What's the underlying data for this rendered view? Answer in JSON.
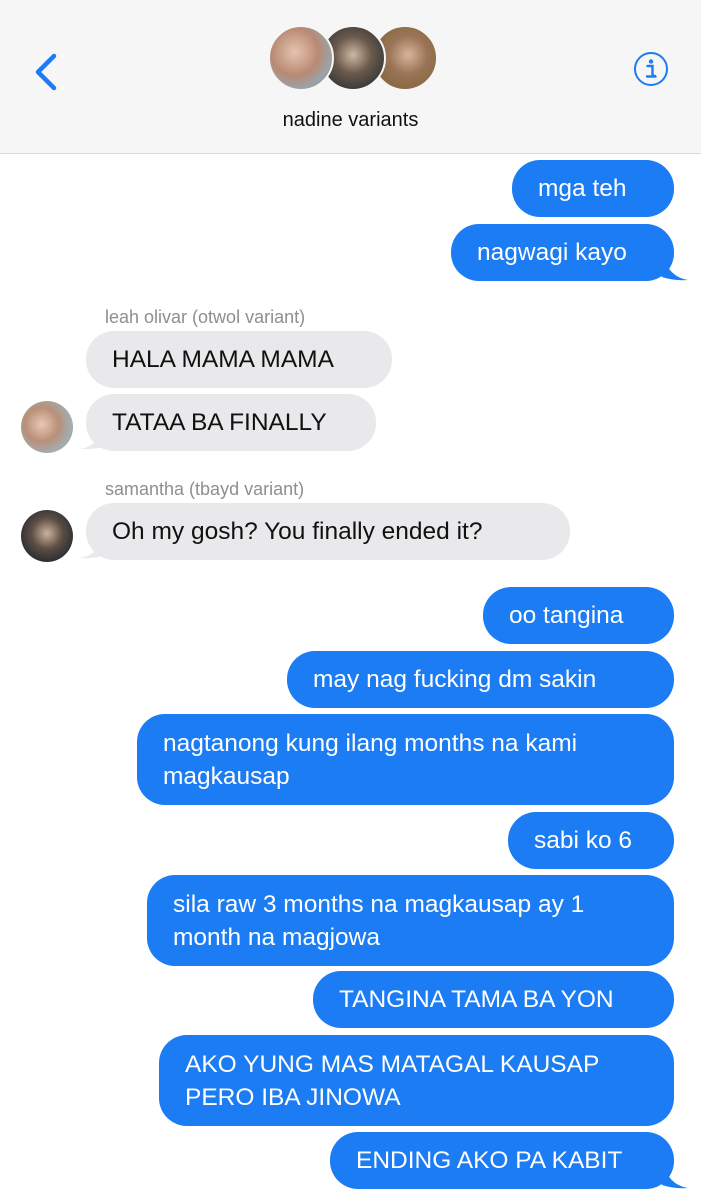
{
  "header": {
    "group_name": "nadine variants",
    "back_icon": "chevron-left-icon",
    "info_icon": "info-icon",
    "accent_color": "#1b7cf3"
  },
  "messages": [
    {
      "id": "m1",
      "dir": "out",
      "text": "mga teh"
    },
    {
      "id": "m2",
      "dir": "out",
      "text": "nagwagi kayo"
    },
    {
      "id": "s1",
      "sender": "leah olivar (otwol variant)"
    },
    {
      "id": "m3",
      "dir": "in",
      "text": "HALA MAMA MAMA"
    },
    {
      "id": "m4",
      "dir": "in",
      "text": "TATAA BA FINALLY"
    },
    {
      "id": "s2",
      "sender": "samantha (tbayd variant)"
    },
    {
      "id": "m5",
      "dir": "in",
      "text": "Oh my gosh? You finally ended it?"
    },
    {
      "id": "m6",
      "dir": "out",
      "text": "oo tangina"
    },
    {
      "id": "m7",
      "dir": "out",
      "text": "may nag fucking dm sakin"
    },
    {
      "id": "m8",
      "dir": "out",
      "lines": [
        "nagtanong kung ilang months na kami",
        "magkausap"
      ]
    },
    {
      "id": "m9",
      "dir": "out",
      "text": "sabi ko 6"
    },
    {
      "id": "m10",
      "dir": "out",
      "lines": [
        "sila raw 3 months na magkausap ay 1",
        "month na magjowa"
      ]
    },
    {
      "id": "m11",
      "dir": "out",
      "text": "TANGINA TAMA BA YON"
    },
    {
      "id": "m12",
      "dir": "out",
      "lines": [
        "AKO YUNG MAS MATAGAL KAUSAP",
        "PERO IBA JINOWA"
      ]
    },
    {
      "id": "m13",
      "dir": "out",
      "text": "ENDING AKO PA KABIT"
    }
  ],
  "colors": {
    "outgoing_bubble": "#1b7cf3",
    "incoming_bubble": "#e9e9eb",
    "sender_label": "#8e8e93"
  }
}
